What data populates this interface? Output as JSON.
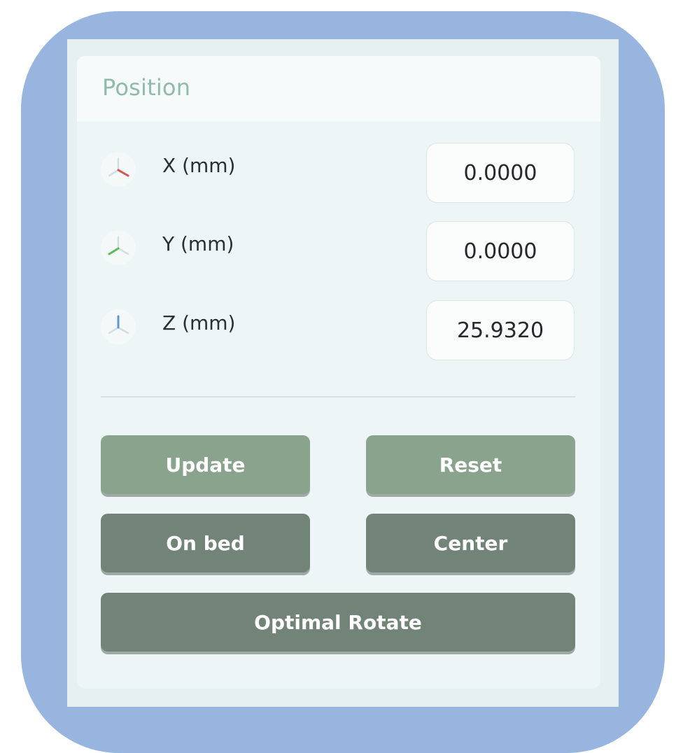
{
  "panel": {
    "title": "Position"
  },
  "axes": [
    {
      "label": "X (mm)",
      "value": "0.0000",
      "icon": "x-axis-icon",
      "color": "#d9534f"
    },
    {
      "label": "Y (mm)",
      "value": "0.0000",
      "icon": "y-axis-icon",
      "color": "#5cb85c"
    },
    {
      "label": "Z (mm)",
      "value": "25.9320",
      "icon": "z-axis-icon",
      "color": "#5b9bd5"
    }
  ],
  "buttons": {
    "update": "Update",
    "reset": "Reset",
    "on_bed": "On bed",
    "center": "Center",
    "optimal_rotate": "Optimal Rotate"
  },
  "colors": {
    "frame": "#97b5de",
    "title": "#8fbcaa",
    "primary_button": "#8aa38c",
    "secondary_button": "#728378"
  }
}
